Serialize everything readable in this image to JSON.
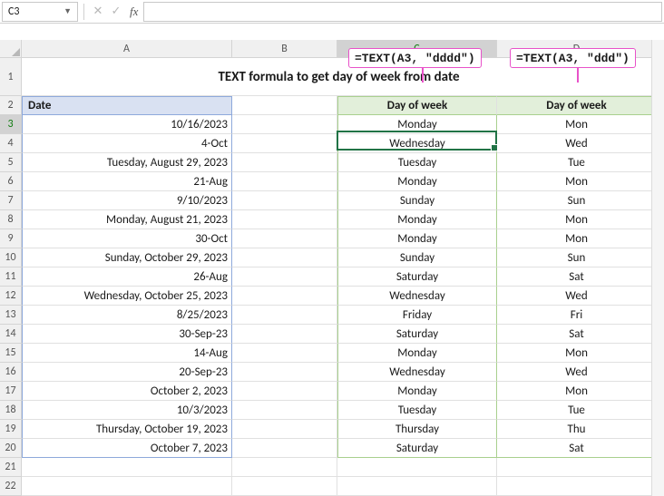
{
  "namebox": "C3",
  "formula_input": "",
  "callout_c": "=TEXT(A3, \"dddd\")",
  "callout_d": "=TEXT(A3, \"ddd\")",
  "columns": [
    "A",
    "B",
    "C",
    "D"
  ],
  "title": "TEXT formula to get day of week from date",
  "headers": {
    "a": "Date",
    "c": "Day of week",
    "d": "Day of week"
  },
  "rows": [
    {
      "n": 3,
      "a": "10/16/2023",
      "c": "Monday",
      "d": "Mon"
    },
    {
      "n": 4,
      "a": "4-Oct",
      "c": "Wednesday",
      "d": "Wed"
    },
    {
      "n": 5,
      "a": "Tuesday, August 29, 2023",
      "c": "Tuesday",
      "d": "Tue"
    },
    {
      "n": 6,
      "a": "21-Aug",
      "c": "Monday",
      "d": "Mon"
    },
    {
      "n": 7,
      "a": "9/10/2023",
      "c": "Sunday",
      "d": "Sun"
    },
    {
      "n": 8,
      "a": "Monday, August 21, 2023",
      "c": "Monday",
      "d": "Mon"
    },
    {
      "n": 9,
      "a": "30-Oct",
      "c": "Monday",
      "d": "Mon"
    },
    {
      "n": 10,
      "a": "Sunday, October 29, 2023",
      "c": "Sunday",
      "d": "Sun"
    },
    {
      "n": 11,
      "a": "26-Aug",
      "c": "Saturday",
      "d": "Sat"
    },
    {
      "n": 12,
      "a": "Wednesday, October 25, 2023",
      "c": "Wednesday",
      "d": "Wed"
    },
    {
      "n": 13,
      "a": "8/25/2023",
      "c": "Friday",
      "d": "Fri"
    },
    {
      "n": 14,
      "a": "30-Sep-23",
      "c": "Saturday",
      "d": "Sat"
    },
    {
      "n": 15,
      "a": "14-Aug",
      "c": "Monday",
      "d": "Mon"
    },
    {
      "n": 16,
      "a": "20-Sep-23",
      "c": "Wednesday",
      "d": "Wed"
    },
    {
      "n": 17,
      "a": "October 2, 2023",
      "c": "Monday",
      "d": "Mon"
    },
    {
      "n": 18,
      "a": "10/3/2023",
      "c": "Tuesday",
      "d": "Tue"
    },
    {
      "n": 19,
      "a": "Thursday, October 19, 2023",
      "c": "Thursday",
      "d": "Thu"
    },
    {
      "n": 20,
      "a": "October 7, 2023",
      "c": "Saturday",
      "d": "Sat"
    }
  ],
  "empty_rows": [
    21,
    22
  ],
  "chart_data": {
    "type": "table",
    "title": "TEXT formula to get day of week from date",
    "columns": [
      "Date",
      "Day of week (dddd)",
      "Day of week (ddd)"
    ],
    "rows": [
      [
        "10/16/2023",
        "Monday",
        "Mon"
      ],
      [
        "4-Oct",
        "Wednesday",
        "Wed"
      ],
      [
        "Tuesday, August 29, 2023",
        "Tuesday",
        "Tue"
      ],
      [
        "21-Aug",
        "Monday",
        "Mon"
      ],
      [
        "9/10/2023",
        "Sunday",
        "Sun"
      ],
      [
        "Monday, August 21, 2023",
        "Monday",
        "Mon"
      ],
      [
        "30-Oct",
        "Monday",
        "Mon"
      ],
      [
        "Sunday, October 29, 2023",
        "Sunday",
        "Sun"
      ],
      [
        "26-Aug",
        "Saturday",
        "Sat"
      ],
      [
        "Wednesday, October 25, 2023",
        "Wednesday",
        "Wed"
      ],
      [
        "8/25/2023",
        "Friday",
        "Fri"
      ],
      [
        "30-Sep-23",
        "Saturday",
        "Sat"
      ],
      [
        "14-Aug",
        "Monday",
        "Mon"
      ],
      [
        "20-Sep-23",
        "Wednesday",
        "Wed"
      ],
      [
        "October 2, 2023",
        "Monday",
        "Mon"
      ],
      [
        "10/3/2023",
        "Tuesday",
        "Tue"
      ],
      [
        "Thursday, October 19, 2023",
        "Thursday",
        "Thu"
      ],
      [
        "October 7, 2023",
        "Saturday",
        "Sat"
      ]
    ]
  }
}
